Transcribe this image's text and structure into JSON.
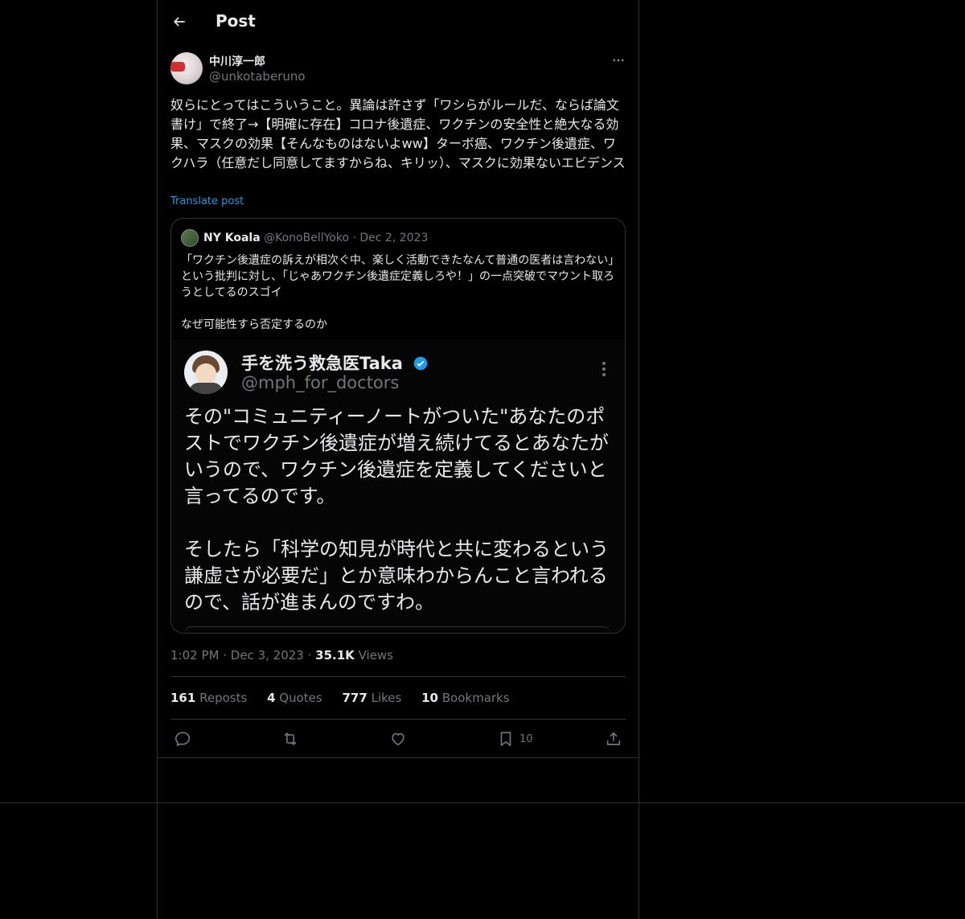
{
  "header": {
    "title": "Post",
    "back_icon": "arrow-left-icon"
  },
  "post": {
    "author_name": "中川淳一郎",
    "author_handle": "@unkotaberuno",
    "text": "奴らにとってはこういうこと。異論は許さず「ワシらがルールだ、ならば論文書け」で終了→【明確に存在】コロナ後遺症、ワクチンの安全性と絶大なる効果、マスクの効果【そんなものはないよww】ターボ癌、ワクチン後遺症、ワクハラ（任意だし同意してますからね、キリッ）、マスクに効果ないエビデンス",
    "translate_label": "Translate post",
    "time": "1:02 PM",
    "date": "Dec 3, 2023",
    "views_count": "35.1K",
    "views_label": "Views"
  },
  "quote": {
    "name": "NY Koala",
    "handle": "@KonoBellYoko",
    "date": "Dec 2, 2023",
    "text": "「ワクチン後遺症の訴えが相次ぐ中、楽しく活動できたなんて普通の医者は言わない」という批判に対し、「じゃあワクチン後遺症定義しろや！」の一点突破でマウント取ろうとしてるのスゴイ\n\nなぜ可能性すら否定するのか",
    "image": {
      "name": "手を洗う救急医Taka",
      "handle": "@mph_for_doctors",
      "text": "その\"コミュニティーノートがついた\"あなたのポストでワクチン後遺症が増え続けてるとあなたがいうので、ワクチン後遺症を定義してくださいと言ってるのです。\n\nそしたら「科学の知見が時代と共に変わるという謙虚さが必要だ」とか意味わからんこと言われるので、話が進まんのですわ。"
    }
  },
  "stats": {
    "reposts_count": "161",
    "reposts_label": "Reposts",
    "quotes_count": "4",
    "quotes_label": "Quotes",
    "likes_count": "777",
    "likes_label": "Likes",
    "bookmarks_count": "10",
    "bookmarks_label": "Bookmarks"
  },
  "actions": {
    "reply_icon": "reply-icon",
    "repost_icon": "repost-icon",
    "like_icon": "heart-icon",
    "bookmark_icon": "bookmark-icon",
    "bookmark_count": "10",
    "share_icon": "share-icon"
  },
  "colors": {
    "background": "#000000",
    "text": "#e7e9ea",
    "secondary": "#71767b",
    "link": "#1d9bf0",
    "border": "#2f3336",
    "verified": "#1d9bf0"
  }
}
